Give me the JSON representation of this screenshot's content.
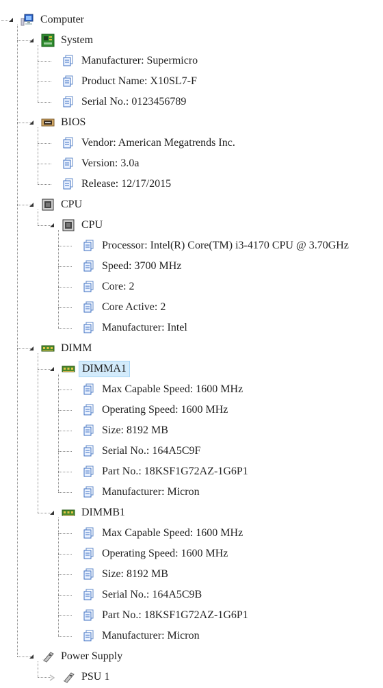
{
  "tree": [
    {
      "label": "Computer",
      "icon": "computer-icon",
      "depth": 0,
      "expander": "expanded",
      "name": "node-computer"
    },
    {
      "label": "System",
      "icon": "motherboard-icon",
      "depth": 1,
      "expander": "expanded",
      "name": "node-system"
    },
    {
      "label": "Manufacturer: Supermicro",
      "icon": "property-icon",
      "depth": 2,
      "expander": "none",
      "name": "node-system-manufacturer"
    },
    {
      "label": "Product Name: X10SL7-F",
      "icon": "property-icon",
      "depth": 2,
      "expander": "none",
      "name": "node-system-product-name"
    },
    {
      "label": "Serial No.: 0123456789",
      "icon": "property-icon",
      "depth": 2,
      "expander": "none",
      "name": "node-system-serial"
    },
    {
      "label": "BIOS",
      "icon": "bios-chip-icon",
      "depth": 1,
      "expander": "expanded",
      "name": "node-bios"
    },
    {
      "label": "Vendor: American Megatrends Inc.",
      "icon": "property-icon",
      "depth": 2,
      "expander": "none",
      "name": "node-bios-vendor"
    },
    {
      "label": "Version: 3.0a",
      "icon": "property-icon",
      "depth": 2,
      "expander": "none",
      "name": "node-bios-version"
    },
    {
      "label": "Release: 12/17/2015",
      "icon": "property-icon",
      "depth": 2,
      "expander": "none",
      "name": "node-bios-release"
    },
    {
      "label": "CPU",
      "icon": "cpu-icon",
      "depth": 1,
      "expander": "expanded",
      "name": "node-cpu-group"
    },
    {
      "label": "CPU",
      "icon": "cpu-icon",
      "depth": 2,
      "expander": "expanded",
      "name": "node-cpu"
    },
    {
      "label": "Processor: Intel(R) Core(TM) i3-4170 CPU @ 3.70GHz",
      "icon": "property-icon",
      "depth": 3,
      "expander": "none",
      "name": "node-cpu-processor"
    },
    {
      "label": "Speed: 3700 MHz",
      "icon": "property-icon",
      "depth": 3,
      "expander": "none",
      "name": "node-cpu-speed"
    },
    {
      "label": "Core: 2",
      "icon": "property-icon",
      "depth": 3,
      "expander": "none",
      "name": "node-cpu-core"
    },
    {
      "label": "Core Active: 2",
      "icon": "property-icon",
      "depth": 3,
      "expander": "none",
      "name": "node-cpu-core-active"
    },
    {
      "label": "Manufacturer: Intel",
      "icon": "property-icon",
      "depth": 3,
      "expander": "none",
      "name": "node-cpu-manufacturer"
    },
    {
      "label": "DIMM",
      "icon": "memory-icon",
      "depth": 1,
      "expander": "expanded",
      "name": "node-dimm-group"
    },
    {
      "label": "DIMMA1",
      "icon": "memory-icon",
      "depth": 2,
      "expander": "expanded",
      "name": "node-dimma1",
      "selected": true
    },
    {
      "label": "Max Capable Speed: 1600 MHz",
      "icon": "property-icon",
      "depth": 3,
      "expander": "none",
      "name": "node-dimma1-max-speed"
    },
    {
      "label": "Operating Speed: 1600 MHz",
      "icon": "property-icon",
      "depth": 3,
      "expander": "none",
      "name": "node-dimma1-operating-speed"
    },
    {
      "label": "Size: 8192 MB",
      "icon": "property-icon",
      "depth": 3,
      "expander": "none",
      "name": "node-dimma1-size"
    },
    {
      "label": "Serial No.: 164A5C9F",
      "icon": "property-icon",
      "depth": 3,
      "expander": "none",
      "name": "node-dimma1-serial"
    },
    {
      "label": "Part No.: 18KSF1G72AZ-1G6P1",
      "icon": "property-icon",
      "depth": 3,
      "expander": "none",
      "name": "node-dimma1-part"
    },
    {
      "label": "Manufacturer: Micron",
      "icon": "property-icon",
      "depth": 3,
      "expander": "none",
      "name": "node-dimma1-manufacturer"
    },
    {
      "label": "DIMMB1",
      "icon": "memory-icon",
      "depth": 2,
      "expander": "expanded",
      "name": "node-dimmb1"
    },
    {
      "label": "Max Capable Speed: 1600 MHz",
      "icon": "property-icon",
      "depth": 3,
      "expander": "none",
      "name": "node-dimmb1-max-speed"
    },
    {
      "label": "Operating Speed: 1600 MHz",
      "icon": "property-icon",
      "depth": 3,
      "expander": "none",
      "name": "node-dimmb1-operating-speed"
    },
    {
      "label": "Size: 8192 MB",
      "icon": "property-icon",
      "depth": 3,
      "expander": "none",
      "name": "node-dimmb1-size"
    },
    {
      "label": "Serial No.: 164A5C9B",
      "icon": "property-icon",
      "depth": 3,
      "expander": "none",
      "name": "node-dimmb1-serial"
    },
    {
      "label": "Part No.: 18KSF1G72AZ-1G6P1",
      "icon": "property-icon",
      "depth": 3,
      "expander": "none",
      "name": "node-dimmb1-part"
    },
    {
      "label": "Manufacturer: Micron",
      "icon": "property-icon",
      "depth": 3,
      "expander": "none",
      "name": "node-dimmb1-manufacturer"
    },
    {
      "label": "Power Supply",
      "icon": "power-supply-icon",
      "depth": 1,
      "expander": "expanded",
      "name": "node-power-supply"
    },
    {
      "label": "PSU 1",
      "icon": "power-supply-icon",
      "depth": 2,
      "expander": "collapsed",
      "name": "node-psu1"
    }
  ],
  "colors": {
    "selection_background": "#d3ebfb",
    "selection_border": "#a7d5f5",
    "connector_lines": "#888888",
    "text": "#222222"
  }
}
